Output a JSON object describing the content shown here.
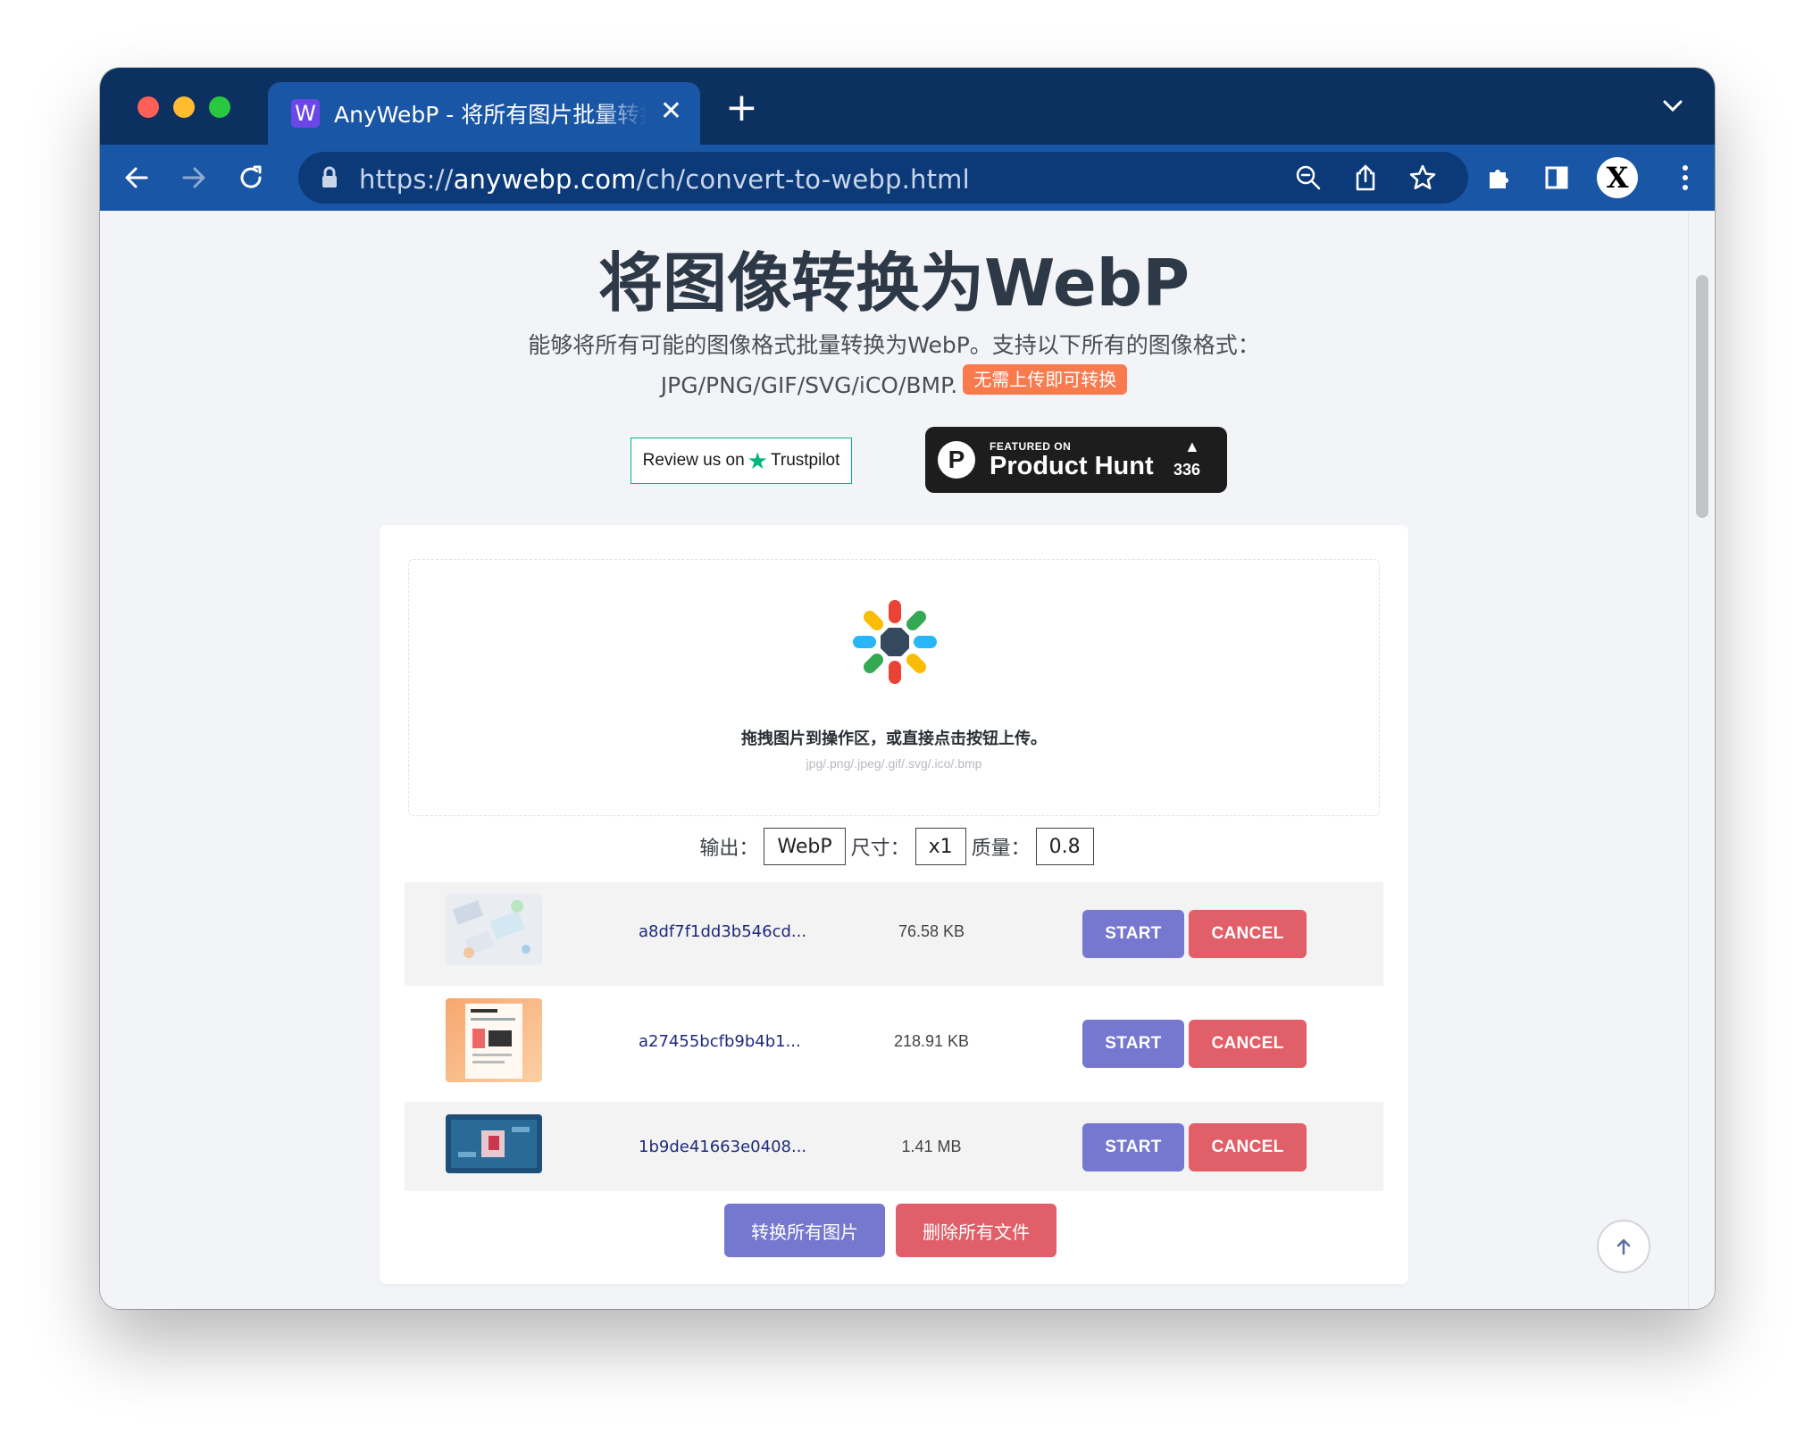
{
  "browser": {
    "tab": {
      "favicon": "W",
      "title": "AnyWebP - 将所有图片批量转换",
      "close_glyph": "✕"
    },
    "new_tab_glyph": "+",
    "url_prefix": "https://",
    "url_host": "anywebp.com",
    "url_path": "/ch/convert-to-webp.html",
    "profile_letter": "X",
    "icons": [
      "back-arrow-icon",
      "forward-arrow-icon",
      "reload-icon",
      "lock-icon",
      "zoom-icon",
      "share-icon",
      "star-icon",
      "extensions-icon",
      "sidepanel-icon",
      "more-icon",
      "tab-menu-chevron-icon"
    ]
  },
  "page": {
    "title": "将图像转换为WebP",
    "subtitle_line1": "能够将所有可能的图像格式批量转换为WebP。支持以下所有的图像格式：",
    "subtitle_line2": "JPG/PNG/GIF/SVG/iCO/BMP.",
    "badge": "无需上传即可转换",
    "trustpilot": {
      "prefix": "Review us on",
      "star": "★",
      "brand": "Trustpilot"
    },
    "producthunt": {
      "logo": "P",
      "small": "FEATURED ON",
      "big": "Product Hunt",
      "arrow": "▲",
      "count": "336"
    }
  },
  "dropzone": {
    "instruction": "拖拽图片到操作区，或直接点击按钮上传。",
    "formats": "jpg/.png/.jpeg/.gif/.svg/.ico/.bmp"
  },
  "options": {
    "output_label": "输出：",
    "output_value": "WebP",
    "size_label": "尺寸：",
    "size_value": "x1",
    "quality_label": "质量：",
    "quality_value": "0.8"
  },
  "files": [
    {
      "name": "a8df7f1dd3b546cd...",
      "size": "76.58 KB",
      "start": "START",
      "cancel": "CANCEL"
    },
    {
      "name": "a27455bcfb9b4b1...",
      "size": "218.91 KB",
      "start": "START",
      "cancel": "CANCEL"
    },
    {
      "name": "1b9de41663e0408...",
      "size": "1.41 MB",
      "start": "START",
      "cancel": "CANCEL"
    }
  ],
  "actions": {
    "convert_all": "转换所有图片",
    "delete_all": "删除所有文件"
  },
  "colors": {
    "titlebar": "#0c3161",
    "toolbar": "#1a56a6",
    "start": "#7677cf",
    "cancel": "#e05f68",
    "badge": "#f97a4c",
    "trustpilot": "#04b67a"
  }
}
